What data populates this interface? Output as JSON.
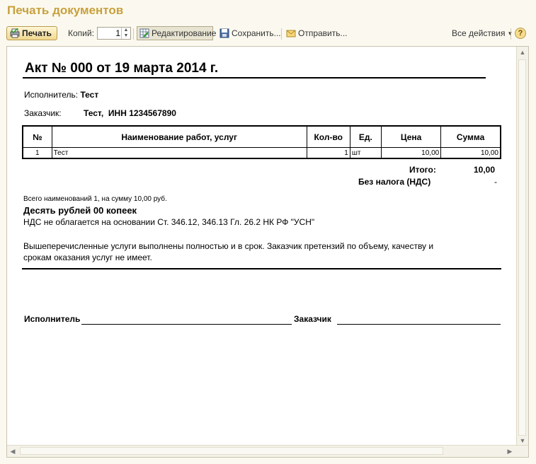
{
  "window": {
    "title": "Печать документов"
  },
  "toolbar": {
    "print": "Печать",
    "copies_label": "Копий:",
    "copies_value": "1",
    "edit": "Редактирование",
    "save": "Сохранить...",
    "send": "Отправить...",
    "all_actions": "Все действия",
    "help": "?"
  },
  "document": {
    "title": "Акт № 000 от 19 марта 2014 г.",
    "executor_label": "Исполнитель:",
    "executor_value": "Тест",
    "customer_label": "Заказчик:",
    "customer_value": "Тест,  ИНН 1234567890",
    "table": {
      "headers": [
        "№",
        "Наименование работ, услуг",
        "Кол-во",
        "Ед.",
        "Цена",
        "Сумма"
      ],
      "rows": [
        {
          "n": "1",
          "name": "Тест",
          "qty": "1",
          "unit": "шт",
          "price": "10,00",
          "sum": "10,00"
        }
      ]
    },
    "total_label": "Итого:",
    "total_value": "10,00",
    "vat_label": "Без налога (НДС)",
    "vat_value": "-",
    "summary_line": "Всего наименований 1, на сумму 10,00 руб.",
    "amount_words": "Десять рублей 00 копеек",
    "vat_note": "НДС не облагается на основании Ст. 346.12, 346.13 Гл. 26.2 НК РФ \"УСН\"",
    "statement_1": "Вышеперечисленные услуги выполнены полностью и в срок. Заказчик претензий по объему, качеству и",
    "statement_2": "срокам оказания услуг не имеет.",
    "sign_executor": "Исполнитель",
    "sign_customer": "Заказчик"
  }
}
